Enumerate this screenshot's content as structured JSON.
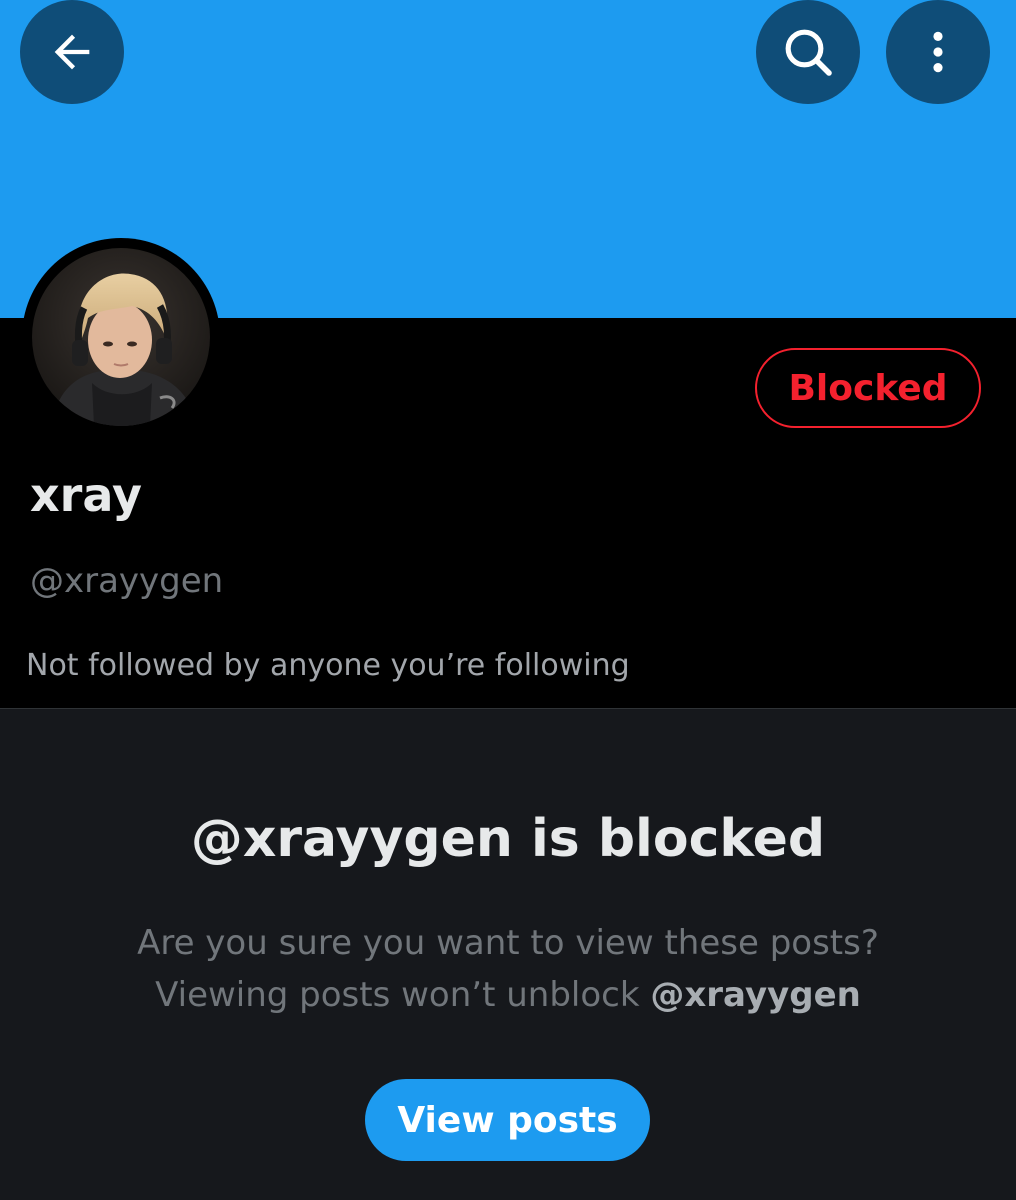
{
  "header": {
    "back_icon": "arrow-left-icon",
    "search_icon": "search-icon",
    "more_icon": "more-vertical-icon"
  },
  "profile": {
    "display_name": "xray",
    "handle": "@xrayygen",
    "blocked_label": "Blocked",
    "followed_note": "Not followed by anyone you’re following"
  },
  "blocked_notice": {
    "title": "@xrayygen is blocked",
    "line1": "Are you sure you want to view these posts?",
    "line2_prefix": "Viewing posts won’t unblock ",
    "line2_handle": "@xrayygen",
    "view_posts_label": "View posts"
  },
  "colors": {
    "banner": "#1d9bf0",
    "blocked_red": "#f4212e",
    "accent_blue": "#1d9bf0"
  }
}
